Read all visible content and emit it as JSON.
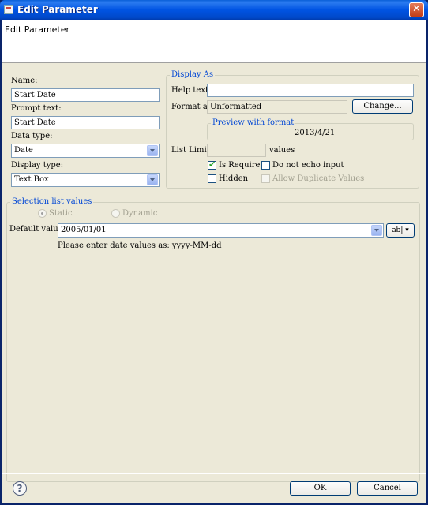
{
  "window": {
    "title": "Edit Parameter",
    "close_symbol": "✕"
  },
  "header": {
    "title": "Edit Parameter"
  },
  "left": {
    "name_label": "Name:",
    "name_value": "Start Date",
    "prompt_label": "Prompt text:",
    "prompt_value": "Start Date",
    "data_type_label": "Data type:",
    "data_type_value": "Date",
    "display_type_label": "Display type:",
    "display_type_value": "Text Box"
  },
  "display_as": {
    "legend": "Display As",
    "help_text_label": "Help text:",
    "help_text_value": "",
    "format_as_label": "Format as:",
    "format_as_value": "Unformatted",
    "change_button": "Change...",
    "preview_legend": "Preview with format",
    "preview_value": "2013/4/21",
    "list_limit_label": "List Limit:",
    "list_limit_value": "",
    "values_label": "values",
    "is_required_label": "Is Required",
    "is_required_checked": true,
    "do_not_echo_label": "Do not echo input",
    "do_not_echo_checked": false,
    "hidden_label": "Hidden",
    "hidden_checked": false,
    "allow_duplicates_label": "Allow Duplicate Values",
    "allow_duplicates_checked": false
  },
  "selection": {
    "legend": "Selection list values",
    "static_label": "Static",
    "dynamic_label": "Dynamic",
    "selected": "Static",
    "default_value_label": "Default value:",
    "default_value": "2005/01/01",
    "abl_button": "ab|",
    "hint": "Please enter date values as: yyyy-MM-dd"
  },
  "footer": {
    "help_symbol": "?",
    "ok_button": "OK",
    "cancel_button": "Cancel"
  }
}
